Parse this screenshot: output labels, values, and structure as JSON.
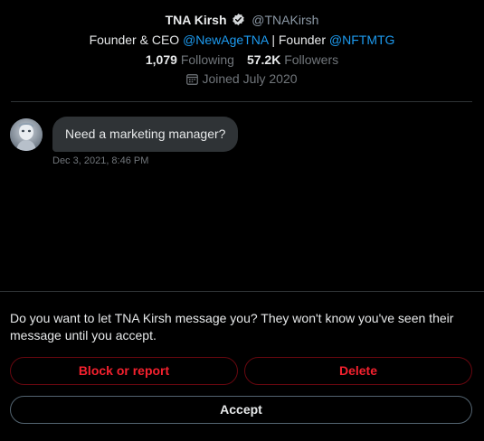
{
  "profile": {
    "display_name": "TNA Kirsh",
    "handle": "@TNAKirsh",
    "bio_prefix": "Founder & CEO ",
    "bio_link1": "@NewAgeTNA",
    "bio_separator": " | Founder ",
    "bio_link2": "@NFTMTG",
    "following_count": "1,079",
    "following_label": "Following",
    "followers_count": "57.2K",
    "followers_label": "Followers",
    "joined": "Joined July 2020"
  },
  "message": {
    "text": "Need a marketing manager?",
    "timestamp": "Dec 3, 2021, 8:46 PM"
  },
  "request": {
    "prompt": "Do you want to let TNA Kirsh message you? They won't know you've seen their message until you accept.",
    "block_label": "Block or report",
    "delete_label": "Delete",
    "accept_label": "Accept"
  },
  "colors": {
    "background": "#000000",
    "link": "#1d9bf0",
    "danger": "#f4212e",
    "secondary_text": "#71767b",
    "bubble": "#2f3336"
  },
  "icons": {
    "verified": "verified-badge-icon",
    "calendar": "calendar-icon"
  }
}
